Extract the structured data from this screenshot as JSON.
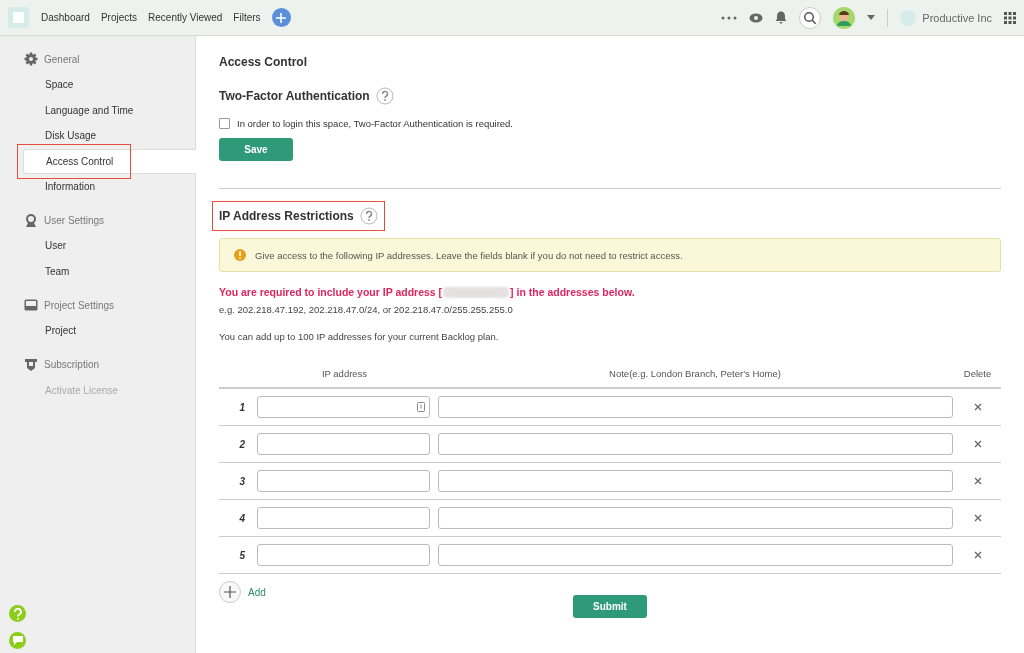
{
  "topbar": {
    "nav": [
      "Dashboard",
      "Projects",
      "Recently Viewed",
      "Filters"
    ],
    "org": "Productive Inc"
  },
  "sidebar": [
    {
      "title": "General",
      "items": [
        {
          "label": "Space",
          "selected": false,
          "disabled": false,
          "highlighted": false
        },
        {
          "label": "Language and Time",
          "selected": false,
          "disabled": false,
          "highlighted": false
        },
        {
          "label": "Disk Usage",
          "selected": false,
          "disabled": false,
          "highlighted": false
        },
        {
          "label": "Access Control",
          "selected": true,
          "disabled": false,
          "highlighted": true
        },
        {
          "label": "Information",
          "selected": false,
          "disabled": false,
          "highlighted": false
        }
      ]
    },
    {
      "title": "User Settings",
      "items": [
        {
          "label": "User",
          "selected": false,
          "disabled": false,
          "highlighted": false
        },
        {
          "label": "Team",
          "selected": false,
          "disabled": false,
          "highlighted": false
        }
      ]
    },
    {
      "title": "Project Settings",
      "items": [
        {
          "label": "Project",
          "selected": false,
          "disabled": false,
          "highlighted": false
        }
      ]
    },
    {
      "title": "Subscription",
      "items": [
        {
          "label": "Activate License",
          "selected": false,
          "disabled": true,
          "highlighted": false
        }
      ]
    }
  ],
  "page_title": "Access Control",
  "two_factor": {
    "heading": "Two-Factor Authentication",
    "checkbox": {
      "label": "In order to login this space, Two-Factor Authentication is required.",
      "checked": false
    },
    "button": "Save"
  },
  "ip_restrictions": {
    "heading": "IP Address Restrictions",
    "highlighted": true,
    "alert": "Give access to the following IP addresses. Leave the fields blank if you do not need to restrict access.",
    "warning_before": "You are required to include your IP address [",
    "warning_after": "] in the addresses below.",
    "example": "e.g. 202.218.47.192, 202.218.47.0/24, or 202.218.47.0/255.255.255.0",
    "limit": "You can add up to 100 IP addresses for your current Backlog plan.",
    "columns": [
      "IP address",
      "Note(e.g. London Branch, Peter's Home)",
      "Delete"
    ],
    "rows": [
      {
        "number": "1"
      },
      {
        "number": "2"
      },
      {
        "number": "3"
      },
      {
        "number": "4"
      },
      {
        "number": "5"
      }
    ],
    "add": "Add",
    "submit": "Submit"
  }
}
